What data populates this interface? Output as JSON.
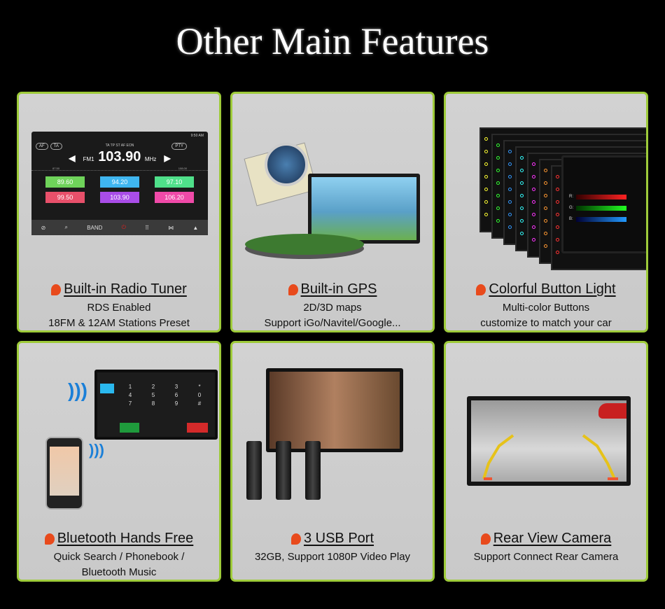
{
  "title": "Other Main Features",
  "accent": "#9ecb3a",
  "pin_color": "#e84a1c",
  "features": [
    {
      "heading": "Built-in Radio Tuner",
      "lines": [
        "RDS Enabled",
        "18FM & 12AM Stations Preset"
      ]
    },
    {
      "heading": "Built-in GPS",
      "lines": [
        "2D/3D maps",
        "Support iGo/Navitel/Google..."
      ]
    },
    {
      "heading": "Colorful Button Light",
      "lines": [
        "Multi-color Buttons",
        "customize to match your car"
      ]
    },
    {
      "heading": "Bluetooth Hands Free",
      "lines": [
        "Quick Search / Phonebook /",
        "Bluetooth Music"
      ]
    },
    {
      "heading": "3 USB Port",
      "lines": [
        "32GB, Support 1080P Video Play"
      ]
    },
    {
      "heading": "Rear View Camera",
      "lines": [
        "Support Connect Rear Camera"
      ]
    }
  ],
  "radio": {
    "status": "9:50 AM",
    "buttons_left": [
      "AF",
      "TA"
    ],
    "flags": "TA  TP  ST  AF  EON",
    "pty": "PTY",
    "band": "FM1",
    "frequency": "103.90",
    "unit": "MHz",
    "scale_min": "87.50",
    "scale_max": "108.00",
    "presets": [
      {
        "f": "89.60",
        "c": "#6fd35a"
      },
      {
        "f": "94.20",
        "c": "#3fb6f0"
      },
      {
        "f": "97.10",
        "c": "#4fe08a"
      },
      {
        "f": "99.50",
        "c": "#e8506a"
      },
      {
        "f": "103.90",
        "c": "#a94de8"
      },
      {
        "f": "106.20",
        "c": "#f04aa8"
      }
    ],
    "band_label": "BAND"
  },
  "rgb": {
    "labels": [
      "R:",
      "G:",
      "B:"
    ]
  },
  "dialpad": [
    "1",
    "2",
    "3",
    "*",
    "4",
    "5",
    "6",
    "0",
    "7",
    "8",
    "9",
    "#"
  ]
}
